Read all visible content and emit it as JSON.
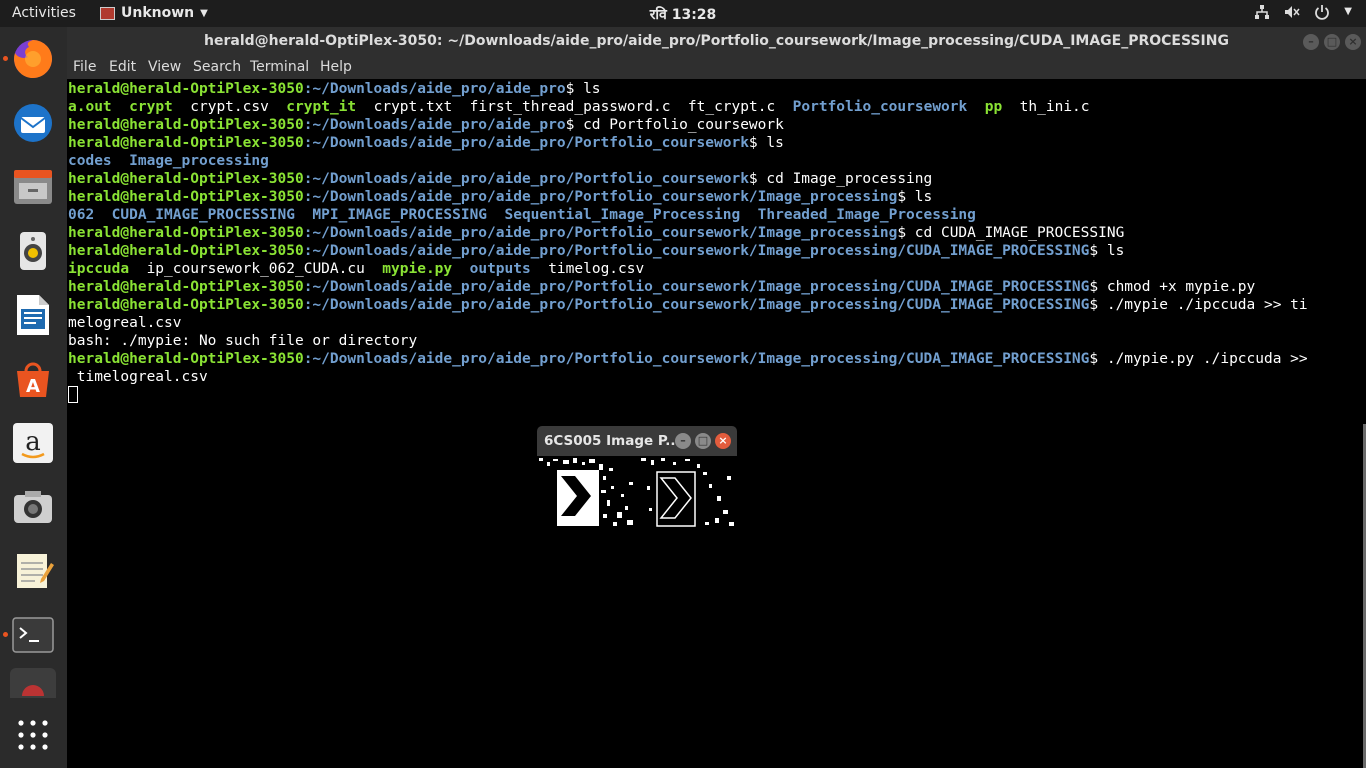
{
  "topbar": {
    "activities": "Activities",
    "app_name": "Unknown",
    "clock": "रवि 13:28",
    "tray_icons": [
      "network-icon",
      "volume-muted-icon",
      "power-icon"
    ]
  },
  "dock": {
    "items": [
      "firefox-icon",
      "thunderbird-icon",
      "files-icon",
      "rhythmbox-icon",
      "writer-icon",
      "software-center-icon",
      "amazon-icon",
      "camera-icon",
      "text-editor-icon",
      "terminal-icon",
      "disk-icon",
      "app-grid-icon"
    ]
  },
  "terminal": {
    "title": "herald@herald-OptiPlex-3050: ~/Downloads/aide_pro/aide_pro/Portfolio_coursework/Image_processing/CUDA_IMAGE_PROCESSING",
    "menu": [
      "File",
      "Edit",
      "View",
      "Search",
      "Terminal",
      "Help"
    ],
    "user": "herald@herald-OptiPlex-3050",
    "lines": {
      "l1_path": ":~/Downloads/aide_pro/aide_pro",
      "l1_cmd": "$ ls",
      "l2_aout": "a.out",
      "l2_crypt": "crypt",
      "l2_cryptcsv": "crypt.csv",
      "l2_cryptit": "crypt_it",
      "l2_rest": "crypt.txt  first_thread_password.c  ft_crypt.c",
      "l2_portfolio": "Portfolio_coursework",
      "l2_pp": "pp",
      "l2_thini": "th_ini.c",
      "l3_path": ":~/Downloads/aide_pro/aide_pro",
      "l3_cmd": "$ cd Portfolio_coursework",
      "l4_path": ":~/Downloads/aide_pro/aide_pro/Portfolio_coursework",
      "l4_cmd": "$ ls",
      "l5_codes": "codes",
      "l5_img": "Image_processing",
      "l6_path": ":~/Downloads/aide_pro/aide_pro/Portfolio_coursework",
      "l6_cmd": "$ cd Image_processing",
      "l7_path": ":~/Downloads/aide_pro/aide_pro/Portfolio_coursework/Image_processing",
      "l7_cmd": "$ ls",
      "l8_dirs": "062  CUDA_IMAGE_PROCESSING  MPI_IMAGE_PROCESSING  Sequential_Image_Processing  Threaded_Image_Processing",
      "l9_path": ":~/Downloads/aide_pro/aide_pro/Portfolio_coursework/Image_processing",
      "l9_cmd": "$ cd CUDA_IMAGE_PROCESSING",
      "l10_path": ":~/Downloads/aide_pro/aide_pro/Portfolio_coursework/Image_processing/CUDA_IMAGE_PROCESSING",
      "l10_cmd": "$ ls",
      "l11_ipccuda": "ipccuda",
      "l11_cu": "ip_coursework_062_CUDA.cu",
      "l11_mypie": "mypie.py",
      "l11_outputs": "outputs",
      "l11_timelog": "timelog.csv",
      "l12_path": ":~/Downloads/aide_pro/aide_pro/Portfolio_coursework/Image_processing/CUDA_IMAGE_PROCESSING",
      "l12_cmd": "$ chmod +x mypie.py",
      "l13_path": ":~/Downloads/aide_pro/aide_pro/Portfolio_coursework/Image_processing/CUDA_IMAGE_PROCESSING",
      "l13_cmd": "$ ./mypie ./ipccuda >> ti",
      "l14": "melogreal.csv",
      "l15": "bash: ./mypie: No such file or directory",
      "l16_path": ":~/Downloads/aide_pro/aide_pro/Portfolio_coursework/Image_processing/CUDA_IMAGE_PROCESSING",
      "l16_cmd": "$ ./mypie.py ./ipccuda >>",
      "l17": " timelogreal.csv"
    }
  },
  "image_window": {
    "title": "6CS005 Image P..."
  }
}
